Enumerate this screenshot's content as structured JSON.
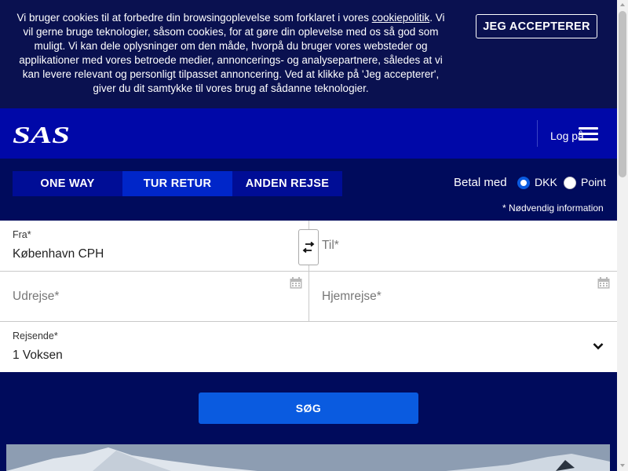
{
  "cookie": {
    "text_before_link": "Vi bruger cookies til at forbedre din browsingoplevelse som forklaret i vores ",
    "link": "cookiepolitik",
    "text_after_link": ". Vi vil gerne bruge teknologier, såsom cookies, for at gøre din oplevelse med os så god som muligt. Vi kan dele oplysninger om den måde, hvorpå du bruger vores websteder og applikationer med vores betroede medier, annoncerings- og analysepartnere, således at vi kan levere relevant og personligt tilpasset annoncering. Ved at klikke på 'Jeg accepterer', giver du dit samtykke til vores brug af sådanne teknologier.",
    "accept_label": "JEG ACCEPTERER"
  },
  "header": {
    "logo_text": "SAS",
    "login_label": "Log på",
    "menu_icon": "hamburger-menu-icon"
  },
  "trip_types": [
    {
      "label": "ONE WAY",
      "active": false
    },
    {
      "label": "TUR RETUR",
      "active": true
    },
    {
      "label": "ANDEN REJSE",
      "active": false
    }
  ],
  "payment": {
    "label": "Betal med",
    "options": [
      {
        "label": "DKK",
        "selected": true
      },
      {
        "label": "Point",
        "selected": false
      }
    ]
  },
  "required_note": "* Nødvendig information",
  "form": {
    "from": {
      "label": "Fra*",
      "value": "København CPH"
    },
    "to": {
      "placeholder": "Til*"
    },
    "depart": {
      "placeholder": "Udrejse*"
    },
    "return": {
      "placeholder": "Hjemrejse*"
    },
    "travellers": {
      "label": "Rejsende*",
      "value": "1 Voksen"
    }
  },
  "search_label": "SØG",
  "colors": {
    "navy": "#000b5c",
    "header_blue": "#0008a8",
    "active_tab": "#0026c9",
    "button_blue": "#0a5be0"
  }
}
